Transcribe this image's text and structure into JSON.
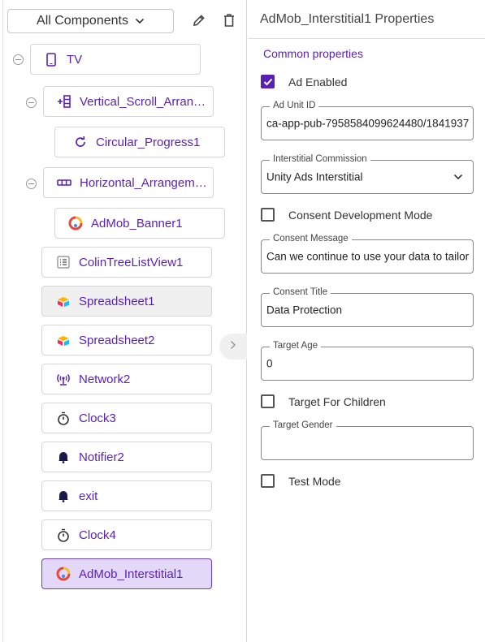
{
  "component_selector": {
    "label": "All Components"
  },
  "tree": {
    "nodes": [
      {
        "label": "TV",
        "icon": "phone-icon"
      },
      {
        "label": "Vertical_Scroll_Arran…",
        "icon": "vertical-scroll-arrangement-icon"
      },
      {
        "label": "Circular_Progress1",
        "icon": "refresh-icon"
      },
      {
        "label": "Horizontal_Arrangem…",
        "icon": "horizontal-arrangement-icon"
      },
      {
        "label": "AdMob_Banner1",
        "icon": "admob-icon"
      },
      {
        "label": "ColinTreeListView1",
        "icon": "list-view-icon"
      },
      {
        "label": "Spreadsheet1",
        "icon": "spreadsheet-icon"
      },
      {
        "label": "Spreadsheet2",
        "icon": "spreadsheet-icon"
      },
      {
        "label": "Network2",
        "icon": "network-icon"
      },
      {
        "label": "Clock3",
        "icon": "stopwatch-icon"
      },
      {
        "label": "Notifier2",
        "icon": "bell-icon"
      },
      {
        "label": "exit",
        "icon": "bell-icon"
      },
      {
        "label": "Clock4",
        "icon": "stopwatch-icon"
      },
      {
        "label": "AdMob_Interstitial1",
        "icon": "admob-icon"
      }
    ]
  },
  "properties": {
    "title": "AdMob_Interstitial1 Properties",
    "section": "Common properties",
    "ad_enabled": {
      "label": "Ad Enabled",
      "checked": true
    },
    "ad_unit_id": {
      "label": "Ad Unit ID",
      "value": "ca-app-pub-7958584099624480/1841937"
    },
    "interstitial_commission": {
      "label": "Interstitial Commission",
      "value": "Unity Ads Interstitial"
    },
    "consent_dev_mode": {
      "label": "Consent Development Mode",
      "checked": false
    },
    "consent_message": {
      "label": "Consent Message",
      "value": "Can we continue to use your data to tailor"
    },
    "consent_title": {
      "label": "Consent Title",
      "value": "Data Protection"
    },
    "target_age": {
      "label": "Target Age",
      "value": "0"
    },
    "target_for_children": {
      "label": "Target For Children",
      "checked": false
    },
    "target_gender": {
      "label": "Target Gender",
      "value": ""
    },
    "test_mode": {
      "label": "Test Mode",
      "checked": false
    }
  },
  "colors": {
    "accent": "#5a1fb5",
    "selected_bg": "#e4d8f8",
    "hover_bg": "#f0f0f0",
    "border": "#d6d6d6"
  }
}
